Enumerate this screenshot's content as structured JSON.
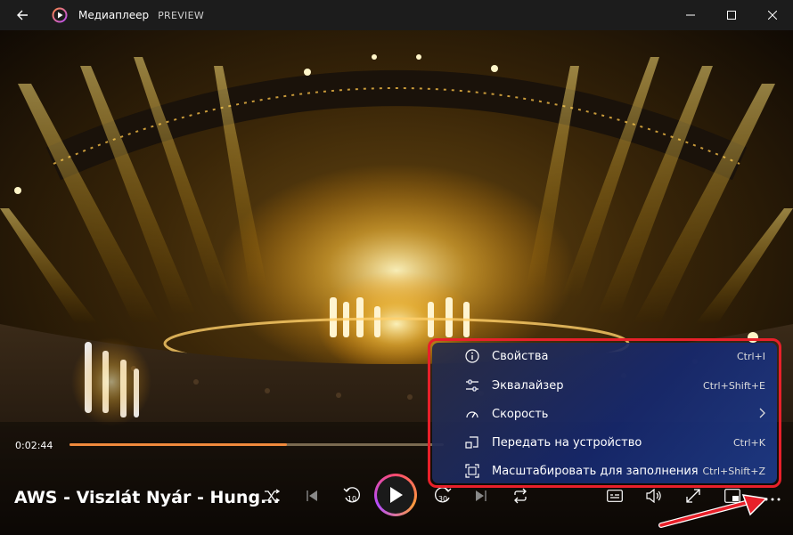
{
  "window": {
    "title": "Медиаплеер",
    "subtitle": "PREVIEW"
  },
  "player": {
    "current_time": "0:02:44",
    "progress_fraction": 0.58,
    "media_title": "AWS - Viszlát Nyár - Hung...",
    "skip_back_seconds": "10",
    "skip_forward_seconds": "30"
  },
  "context_menu": {
    "items": [
      {
        "label": "Свойства",
        "shortcut": "Ctrl+I",
        "icon": "info-icon"
      },
      {
        "label": "Эквалайзер",
        "shortcut": "Ctrl+Shift+E",
        "icon": "equalizer-icon"
      },
      {
        "label": "Скорость",
        "shortcut": "",
        "icon": "speed-icon",
        "submenu": true
      },
      {
        "label": "Передать на устройство",
        "shortcut": "Ctrl+K",
        "icon": "cast-icon"
      },
      {
        "label": "Масштабировать для заполнения",
        "shortcut": "Ctrl+Shift+Z",
        "icon": "scale-icon"
      }
    ]
  },
  "colors": {
    "accent": "#f08a3c",
    "highlight_outline": "#e8202a",
    "titlebar": "#1c1c1c"
  }
}
